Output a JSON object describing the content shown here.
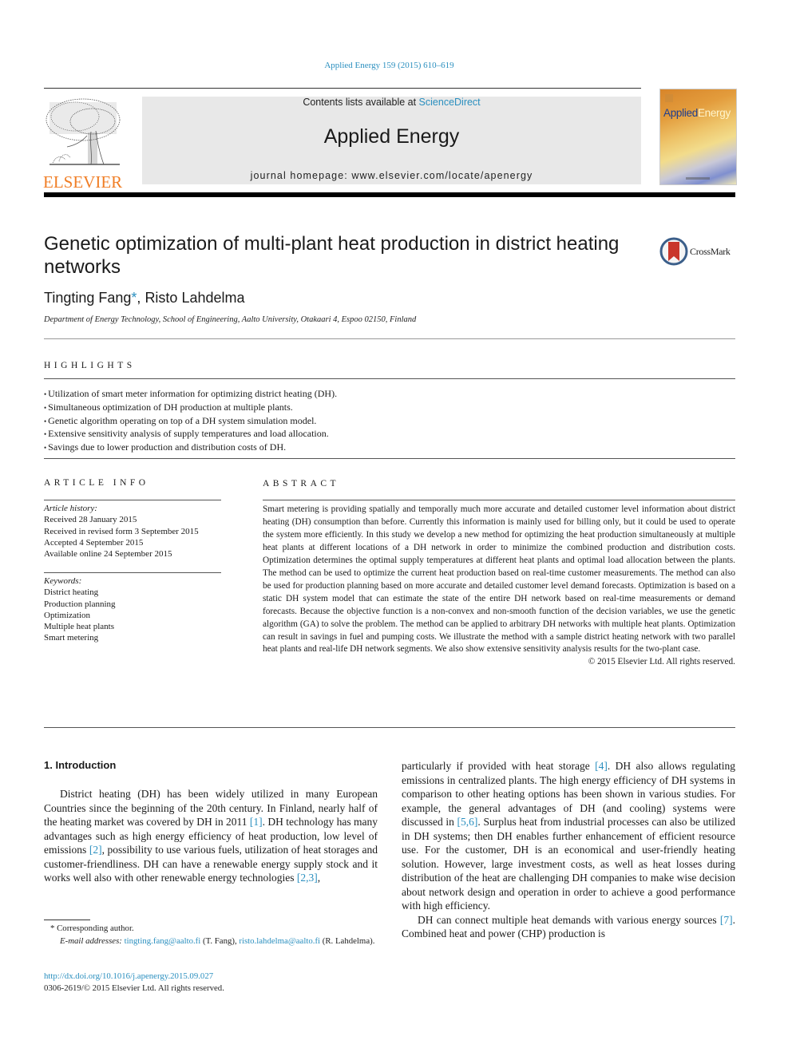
{
  "header": {
    "journal_ref": "Applied Energy 159 (2015) 610–619",
    "contents_prefix": "Contents lists available at ",
    "contents_link": "ScienceDirect",
    "journal_name": "Applied Energy",
    "homepage": "journal homepage: www.elsevier.com/locate/apenergy",
    "publisher_logo_text": "ELSEVIER",
    "cover_title_part1": "Applied",
    "cover_title_part2": "Energy",
    "colors": {
      "link": "#2a8fbf",
      "elsevier_orange": "#f07e26",
      "masthead_bg": "#e8e8e8"
    }
  },
  "article": {
    "title": "Genetic optimization of multi-plant heat production in district heating networks",
    "crossmark_label": "CrossMark",
    "authors": [
      {
        "name": "Tingting Fang",
        "mark": "*"
      },
      {
        "name": "Risto Lahdelma",
        "mark": ""
      }
    ],
    "author_separator": ", ",
    "affiliation": "Department of Energy Technology, School of Engineering, Aalto University, Otakaari 4, Espoo 02150, Finland"
  },
  "highlights": {
    "label": "HIGHLIGHTS",
    "items": [
      "Utilization of smart meter information for optimizing district heating (DH).",
      "Simultaneous optimization of DH production at multiple plants.",
      "Genetic algorithm operating on top of a DH system simulation model.",
      "Extensive sensitivity analysis of supply temperatures and load allocation.",
      "Savings due to lower production and distribution costs of DH."
    ]
  },
  "article_info": {
    "label": "ARTICLE INFO",
    "history_label": "Article history:",
    "history": [
      "Received 28 January 2015",
      "Received in revised form 3 September 2015",
      "Accepted 4 September 2015",
      "Available online 24 September 2015"
    ],
    "keywords_label": "Keywords:",
    "keywords": [
      "District heating",
      "Production planning",
      "Optimization",
      "Multiple heat plants",
      "Smart metering"
    ]
  },
  "abstract": {
    "label": "ABSTRACT",
    "text": "Smart metering is providing spatially and temporally much more accurate and detailed customer level information about district heating (DH) consumption than before. Currently this information is mainly used for billing only, but it could be used to operate the system more efficiently. In this study we develop a new method for optimizing the heat production simultaneously at multiple heat plants at different locations of a DH network in order to minimize the combined production and distribution costs. Optimization determines the optimal supply temperatures at different heat plants and optimal load allocation between the plants. The method can be used to optimize the current heat production based on real-time customer measurements. The method can also be used for production planning based on more accurate and detailed customer level demand forecasts. Optimization is based on a static DH system model that can estimate the state of the entire DH network based on real-time measurements or demand forecasts. Because the objective function is a non-convex and non-smooth function of the decision variables, we use the genetic algorithm (GA) to solve the problem. The method can be applied to arbitrary DH networks with multiple heat plants. Optimization can result in savings in fuel and pumping costs. We illustrate the method with a sample district heating network with two parallel heat plants and real-life DH network segments. We also show extensive sensitivity analysis results for the two-plant case.",
    "copyright": "© 2015 Elsevier Ltd. All rights reserved."
  },
  "introduction": {
    "heading": "1. Introduction",
    "left_column": [
      {
        "t": "District heating (DH) has been widely utilized in many European Countries since the beginning of the 20th century. In Finland, nearly half of the heating market was covered by DH in 2011 "
      },
      {
        "ref": "[1]"
      },
      {
        "t": ". DH technology has many advantages such as high energy efficiency of heat production, low level of emissions "
      },
      {
        "ref": "[2]"
      },
      {
        "t": ", possibility to use various fuels, utilization of heat storages and customer-friendliness. DH can have a renewable energy supply stock and it works well also with other renewable energy technologies "
      },
      {
        "ref": "[2,3]"
      },
      {
        "t": ","
      }
    ],
    "right_column_p1": [
      {
        "t": "particularly if provided with heat storage "
      },
      {
        "ref": "[4]"
      },
      {
        "t": ". DH also allows regulating emissions in centralized plants. The high energy efficiency of DH systems in comparison to other heating options has been shown in various studies. For example, the general advantages of DH (and cooling) systems were discussed in "
      },
      {
        "ref": "[5,6]"
      },
      {
        "t": ". Surplus heat from industrial processes can also be utilized in DH systems; then DH enables further enhancement of efficient resource use. For the customer, DH is an economical and user-friendly heating solution. However, large investment costs, as well as heat losses during distribution of the heat are challenging DH companies to make wise decision about network design and operation in order to achieve a good performance with high efficiency."
      }
    ],
    "right_column_p2": [
      {
        "t": "DH can connect multiple heat demands with various energy sources "
      },
      {
        "ref": "[7]"
      },
      {
        "t": ". Combined heat and power (CHP) production is"
      }
    ]
  },
  "footnotes": {
    "corresponding": "* Corresponding author.",
    "email_label": "E-mail addresses: ",
    "emails": [
      {
        "address": "tingting.fang@aalto.fi",
        "who": " (T. Fang), "
      },
      {
        "address": "risto.lahdelma@aalto.fi",
        "who": " (R. Lahdelma)."
      }
    ],
    "doi": "http://dx.doi.org/10.1016/j.apenergy.2015.09.027",
    "issn_copyright": "0306-2619/© 2015 Elsevier Ltd. All rights reserved."
  }
}
